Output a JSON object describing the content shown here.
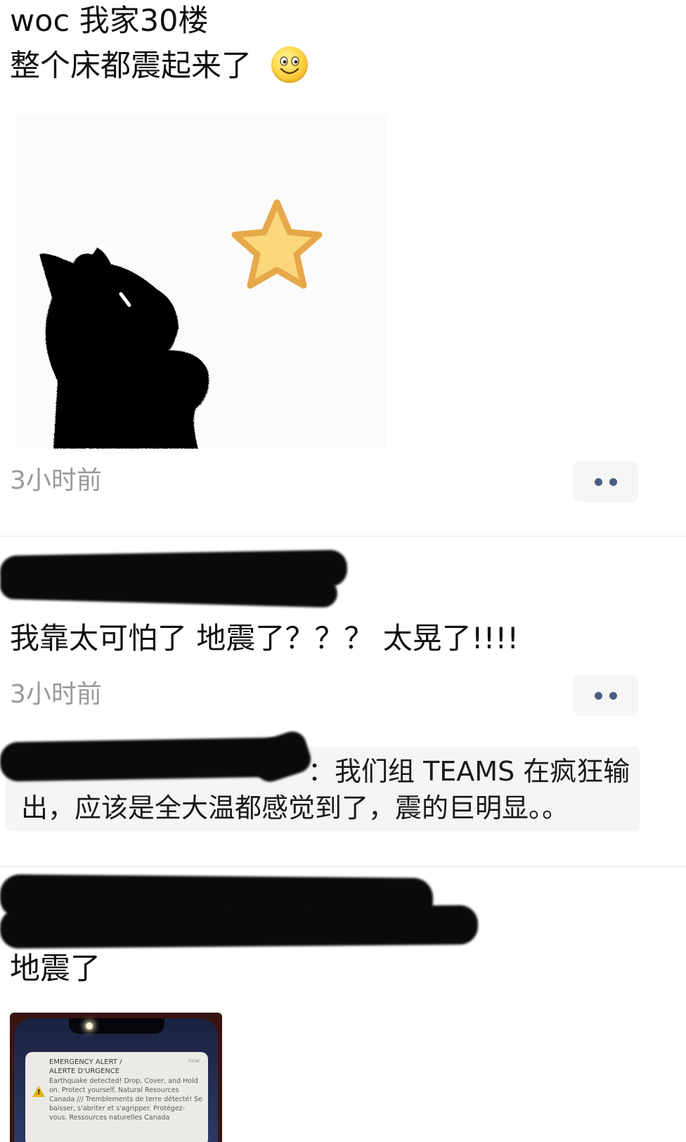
{
  "post1": {
    "line1": "woc 我家30楼",
    "line2": "整个床都震起来了",
    "emoji_icon": "smiley-face-icon",
    "sticker": "black-cat-looking-at-star-sticker",
    "time": "3小时前"
  },
  "post2": {
    "text": "我靠太可怕了 地震了？？？ 太晃了!!!!",
    "time": "3小时前",
    "reply": {
      "line1": "：我们组 TEAMS 在疯狂输",
      "line2": "出，应该是全大温都感觉到了，震的巨明显。。"
    }
  },
  "post3": {
    "text": "地震了",
    "alert": {
      "title1": "EMERGENCY ALERT /",
      "title2": "ALERTE D'URGENCE",
      "now": "now",
      "body": [
        "Earthquake detected! Drop, Cover, and Hold",
        "on. Protect yourself. Natural Resources",
        "Canada /// Tremblements de terre détecté! Se",
        "baisser, s'abriter et s'agripper. Protégez-",
        "vous. Ressources naturelles Canada"
      ]
    }
  },
  "colors": {
    "more_dots": "#4a5d82",
    "time_text": "#9a9a9a",
    "reply_bg": "#f5f5f5",
    "star_fill": "#f9d77a",
    "star_outline": "#e6a84a"
  },
  "icons": [
    "smiley-face-icon",
    "more-options-icon",
    "warning-icon",
    "star-icon"
  ]
}
